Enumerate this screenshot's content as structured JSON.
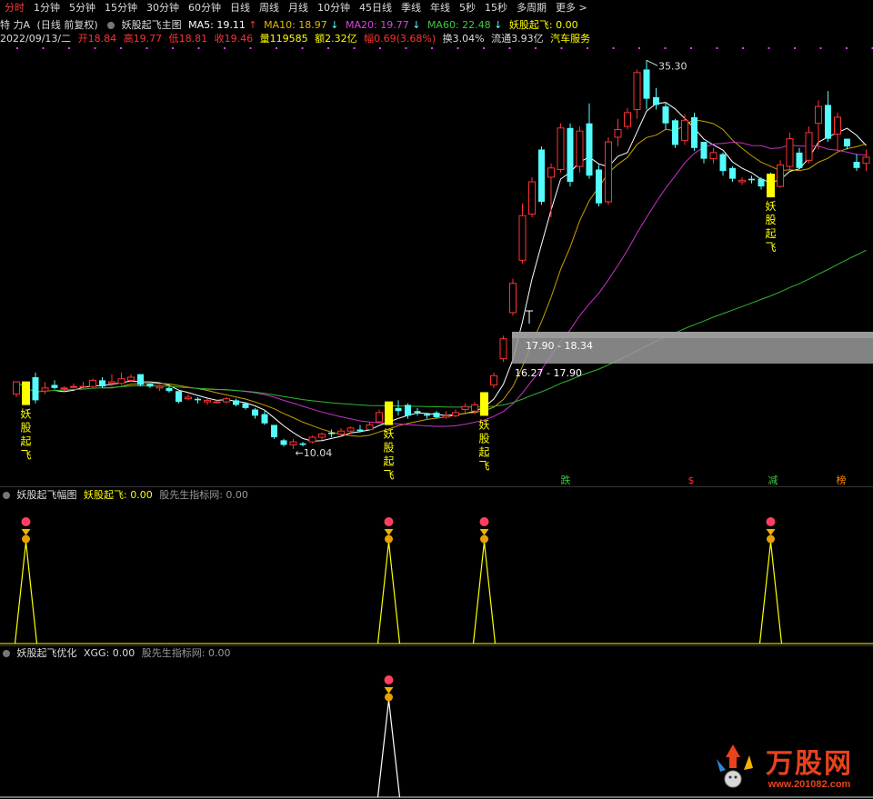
{
  "toolbar": {
    "tabs": [
      "分时",
      "1分钟",
      "5分钟",
      "15分钟",
      "30分钟",
      "60分钟",
      "日线",
      "周线",
      "月线",
      "10分钟",
      "45日线",
      "季线",
      "年线",
      "5秒",
      "15秒",
      "多周期",
      "更多 >"
    ],
    "active_index": 0
  },
  "info": {
    "stock_name": "特 力A",
    "period_note": "(日线 前复权)",
    "main_indicator": "妖股起飞主图",
    "ma5": "MA5: 19.11",
    "ma10": "MA10: 18.97",
    "ma20": "MA20: 19.77",
    "ma60": "MA60: 22.48",
    "signal": "妖股起飞: 0.00",
    "date": "2022/09/13/二",
    "open": "开18.84",
    "high": "高19.77",
    "low": "低18.81",
    "close": "收19.46",
    "volume": "量119585",
    "amount": "额2.32亿",
    "change": "幅0.69(3.68%)",
    "turnover": "换3.04%",
    "float": "流通3.93亿",
    "industry": "汽车服务"
  },
  "indicator1": {
    "name": "妖股起飞幅图",
    "value": "妖股起飞: 0.00",
    "source": "股先生指标网: 0.00"
  },
  "indicator2": {
    "name": "妖股起飞优化",
    "value": "XGG: 0.00",
    "source": "股先生指标网: 0.00"
  },
  "watermark": {
    "title": "万股网",
    "url": "www.201082.com"
  },
  "colors": {
    "up": "#ff3232",
    "down": "#54fcfc",
    "ma5": "#ffffff",
    "ma10": "#c8a000",
    "ma20": "#c832c8",
    "ma60": "#32b432",
    "signal": "#ffff00",
    "gray_band": "#9a9a9a"
  },
  "chart_data": {
    "type": "candlestick",
    "series_names": [
      "MA5",
      "MA10",
      "MA20",
      "MA60"
    ],
    "annotations": {
      "high_label": "35.30",
      "low_label": "10.04",
      "range_band_1": "17.90 - 18.34",
      "range_band_2": "16.27 - 17.90",
      "signal_text": "妖股起飞",
      "markers": [
        "跌",
        "$",
        "减",
        "榜"
      ]
    },
    "candles": [
      [
        13.6,
        14.4,
        13.4,
        13.6
      ],
      [
        13.7,
        13.6,
        13.4,
        14.2
      ],
      [
        14.7,
        13.2,
        13.0,
        15.0
      ],
      [
        13.8,
        14.0,
        13.6,
        14.4
      ],
      [
        14.2,
        14.0,
        13.9,
        14.5
      ],
      [
        14.0,
        14.0,
        13.8,
        14.1
      ],
      [
        14.1,
        14.1,
        14.0,
        14.3
      ],
      [
        14.1,
        14.1,
        13.9,
        14.4
      ],
      [
        14.1,
        14.5,
        14.0,
        14.6
      ],
      [
        14.5,
        14.1,
        14.0,
        14.7
      ],
      [
        14.3,
        14.4,
        14.1,
        14.9
      ],
      [
        14.3,
        14.6,
        14.2,
        15.0
      ],
      [
        14.5,
        14.7,
        14.4,
        14.9
      ],
      [
        14.9,
        14.2,
        14.1,
        14.9
      ],
      [
        14.3,
        14.1,
        14.0,
        14.3
      ],
      [
        14.0,
        14.1,
        13.8,
        14.2
      ],
      [
        14.0,
        13.8,
        13.7,
        14.1
      ],
      [
        13.8,
        13.1,
        13.0,
        13.8
      ],
      [
        13.3,
        13.4,
        13.2,
        13.6
      ],
      [
        13.3,
        13.2,
        13.0,
        13.4
      ],
      [
        13.1,
        13.2,
        12.9,
        13.3
      ],
      [
        13.1,
        13.1,
        13.0,
        13.2
      ],
      [
        13.1,
        13.3,
        13.0,
        13.4
      ],
      [
        13.2,
        12.9,
        12.8,
        13.3
      ],
      [
        13.0,
        12.7,
        12.6,
        13.0
      ],
      [
        12.6,
        12.2,
        12.0,
        12.7
      ],
      [
        12.3,
        11.7,
        11.6,
        12.5
      ],
      [
        11.6,
        10.8,
        10.7,
        11.6
      ],
      [
        10.6,
        10.3,
        10.2,
        10.7
      ],
      [
        10.3,
        10.5,
        10.04,
        10.7
      ],
      [
        10.4,
        10.3,
        10.2,
        10.5
      ],
      [
        10.5,
        10.8,
        10.4,
        10.9
      ],
      [
        10.8,
        11.0,
        10.6,
        11.1
      ],
      [
        11.1,
        11.0,
        10.8,
        11.3
      ],
      [
        11.0,
        11.2,
        10.9,
        11.4
      ],
      [
        11.2,
        11.4,
        11.0,
        11.5
      ],
      [
        11.3,
        11.2,
        11.1,
        11.6
      ],
      [
        11.3,
        11.6,
        11.2,
        11.8
      ],
      [
        11.8,
        12.4,
        11.7,
        12.6
      ],
      [
        12.3,
        12.4,
        12.0,
        12.8
      ],
      [
        12.7,
        12.5,
        12.2,
        13.2
      ],
      [
        12.9,
        12.2,
        12.0,
        13.0
      ],
      [
        12.5,
        12.4,
        12.2,
        12.7
      ],
      [
        12.3,
        12.2,
        12.0,
        12.4
      ],
      [
        12.4,
        12.1,
        12.0,
        12.5
      ],
      [
        12.1,
        12.2,
        12.0,
        12.5
      ],
      [
        12.2,
        12.4,
        12.1,
        12.6
      ],
      [
        12.6,
        12.8,
        12.4,
        13.0
      ],
      [
        12.5,
        12.9,
        12.3,
        13.1
      ],
      [
        12.9,
        13.5,
        12.8,
        13.7
      ],
      [
        14.2,
        14.8,
        14.0,
        15.0
      ],
      [
        15.9,
        17.2,
        15.7,
        17.4
      ],
      [
        18.9,
        20.8,
        18.7,
        21.1
      ],
      [
        22.3,
        25.2,
        22.1,
        26.0
      ],
      [
        25.3,
        27.4,
        25.1,
        27.7
      ],
      [
        29.5,
        26.1,
        25.9,
        29.7
      ],
      [
        27.7,
        28.3,
        25.1,
        28.6
      ],
      [
        28.2,
        30.9,
        28.0,
        31.2
      ],
      [
        30.9,
        27.4,
        27.1,
        31.2
      ],
      [
        28.4,
        30.7,
        28.0,
        31.0
      ],
      [
        31.2,
        27.8,
        27.6,
        32.5
      ],
      [
        28.2,
        26.0,
        25.8,
        28.5
      ],
      [
        26.1,
        30.0,
        25.9,
        30.3
      ],
      [
        30.3,
        30.8,
        29.7,
        31.5
      ],
      [
        31.0,
        31.9,
        30.8,
        32.2
      ],
      [
        32.1,
        34.5,
        31.5,
        34.7
      ],
      [
        34.7,
        32.8,
        32.1,
        35.3
      ],
      [
        32.9,
        32.4,
        32.1,
        33.5
      ],
      [
        32.3,
        31.2,
        30.8,
        32.5
      ],
      [
        31.4,
        29.8,
        29.6,
        31.5
      ],
      [
        30.1,
        31.4,
        29.8,
        31.8
      ],
      [
        31.6,
        29.6,
        29.4,
        31.9
      ],
      [
        30.0,
        28.9,
        28.6,
        30.0
      ],
      [
        28.9,
        29.3,
        28.6,
        29.6
      ],
      [
        29.2,
        28.1,
        27.8,
        29.3
      ],
      [
        28.3,
        27.6,
        27.4,
        28.4
      ],
      [
        27.4,
        27.5,
        27.2,
        27.7
      ],
      [
        27.6,
        27.5,
        27.3,
        27.8
      ],
      [
        27.6,
        27.1,
        26.9,
        27.7
      ],
      [
        27.6,
        27.1,
        26.9,
        28.0
      ],
      [
        27.1,
        28.5,
        27.0,
        28.8
      ],
      [
        28.4,
        30.2,
        28.2,
        30.6
      ],
      [
        29.3,
        28.3,
        28.2,
        29.6
      ],
      [
        28.8,
        30.6,
        28.6,
        31.0
      ],
      [
        31.2,
        32.3,
        29.5,
        32.7
      ],
      [
        32.4,
        30.2,
        30.0,
        33.3
      ],
      [
        30.5,
        31.6,
        29.4,
        31.9
      ],
      [
        30.2,
        29.7,
        29.5,
        30.2
      ],
      [
        28.7,
        28.3,
        28.1,
        29.2
      ],
      [
        28.6,
        29.0,
        28.1,
        29.5
      ]
    ],
    "signal_bars": [
      1,
      39,
      49,
      79
    ],
    "y_range": [
      9.5,
      36.5
    ]
  }
}
